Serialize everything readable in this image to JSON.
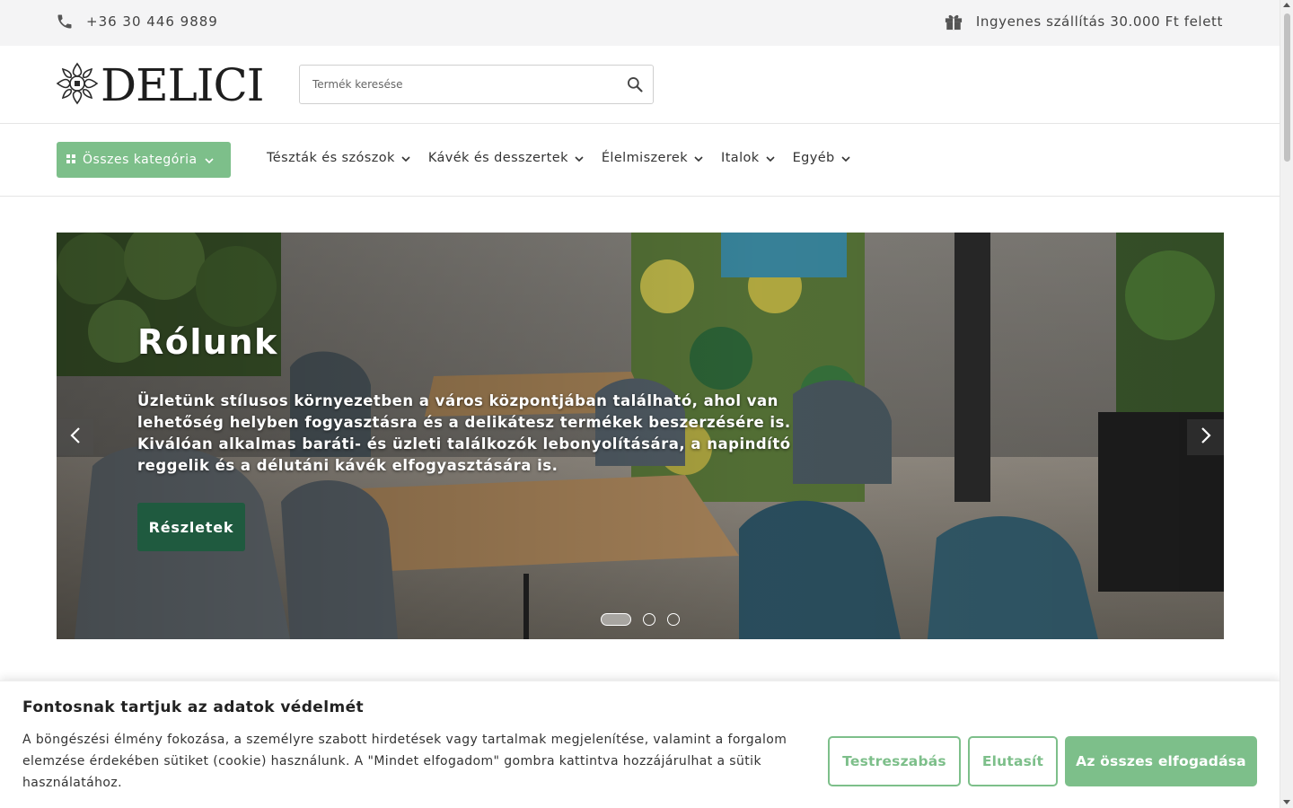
{
  "topbar": {
    "phone": "+36 30 446 9889",
    "phone_icon": "phone-icon",
    "shipping": "Ingyenes szállítás 30.000 Ft felett",
    "shipping_icon": "gift-icon"
  },
  "header": {
    "logo_text": "DELICI",
    "search": {
      "placeholder": "Termék keresése",
      "value": "",
      "icon": "search-icon"
    }
  },
  "nav": {
    "all_categories": "Összes kategória",
    "items": [
      {
        "label": "Tészták és szószok"
      },
      {
        "label": "Kávék és desszertek"
      },
      {
        "label": "Élelmiszerek"
      },
      {
        "label": "Italok"
      },
      {
        "label": "Egyéb"
      }
    ]
  },
  "hero": {
    "title": "Rólunk",
    "text": "Üzletünk stílusos környezetben a város központjában található, ahol van lehetőség helyben fogyasztásra és a delikátesz termékek beszerzésére is. Kiválóan alkalmas baráti- és üzleti találkozók lebonyolítására, a napindító reggelik és a délutáni kávék elfogyasztására is.",
    "button": "Részletek",
    "slides": 3,
    "active_slide": 1
  },
  "cookie": {
    "title": "Fontosnak tartjuk az adatok védelmét",
    "text": "A böngészési élmény fokozása, a személyre szabott hirdetések vagy tartalmak megjelenítése, valamint a forgalom elemzése érdekében sütiket (cookie) használunk. A \"Mindet elfogadom\" gombra kattintva hozzájárulhat a sütik használatához.",
    "customize": "Testreszabás",
    "reject": "Elutasít",
    "accept_all": "Az összes elfogadása"
  },
  "colors": {
    "accent_green": "#7dbf8a",
    "dark_green": "#1f5a3f",
    "topbar_bg": "#f4f4f5"
  }
}
